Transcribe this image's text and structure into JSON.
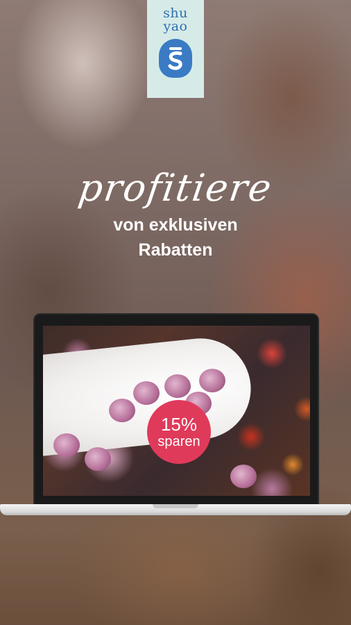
{
  "brand": {
    "line1": "shu",
    "line2": "yao",
    "mark_letter": "S",
    "bg_color": "#d6ebe8",
    "mark_color": "#3a7bc4"
  },
  "headline": {
    "script": "profitiere",
    "line1": "von exklusiven",
    "line2": "Rabatten"
  },
  "badge": {
    "percent": "15%",
    "word": "sparen",
    "color": "#e03a5a"
  }
}
